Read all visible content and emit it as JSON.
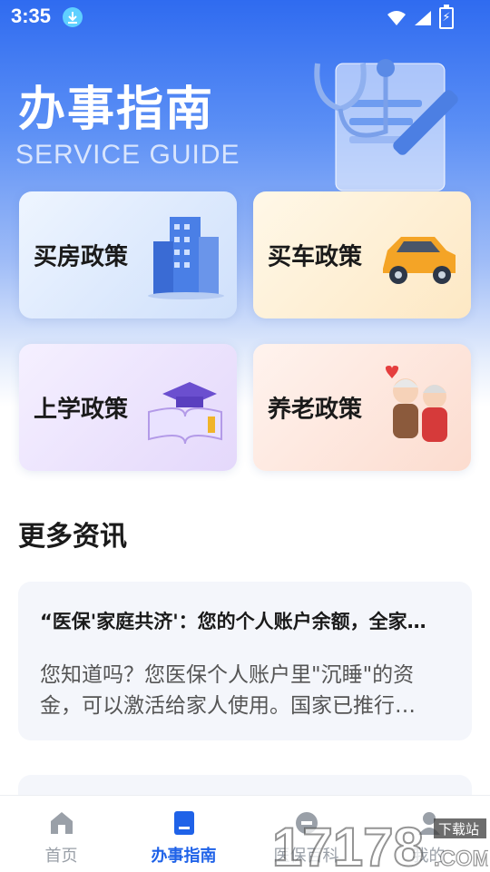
{
  "status_bar": {
    "time": "3:35"
  },
  "header": {
    "title": "办事指南",
    "subtitle": "SERVICE GUIDE"
  },
  "cards": [
    {
      "label": "买房政策",
      "icon": "building-icon"
    },
    {
      "label": "买车政策",
      "icon": "car-icon"
    },
    {
      "label": "上学政策",
      "icon": "graduation-book-icon"
    },
    {
      "label": "养老政策",
      "icon": "elderly-couple-icon"
    }
  ],
  "more": {
    "title": "更多资讯",
    "articles": [
      {
        "title": "“医保'家庭共济'：您的个人账户余额，全家…",
        "summary": "您知道吗？您医保个人账户里\"沉睡\"的资金，可以激活给家人使用。国家已推行…"
      }
    ]
  },
  "tabs": [
    {
      "label": "首页",
      "icon": "home-icon",
      "active": false
    },
    {
      "label": "办事指南",
      "icon": "book-icon",
      "active": true
    },
    {
      "label": "医保百科",
      "icon": "encyclopedia-icon",
      "active": false
    },
    {
      "label": "我的",
      "icon": "profile-icon",
      "active": false
    }
  ],
  "watermark": {
    "text": "17178",
    "badge": "下载站",
    "suffix": ".COM"
  },
  "colors": {
    "primary": "#1f62e8",
    "hero_top": "#2f6bf0",
    "tab_inactive": "#9aa0a8"
  }
}
